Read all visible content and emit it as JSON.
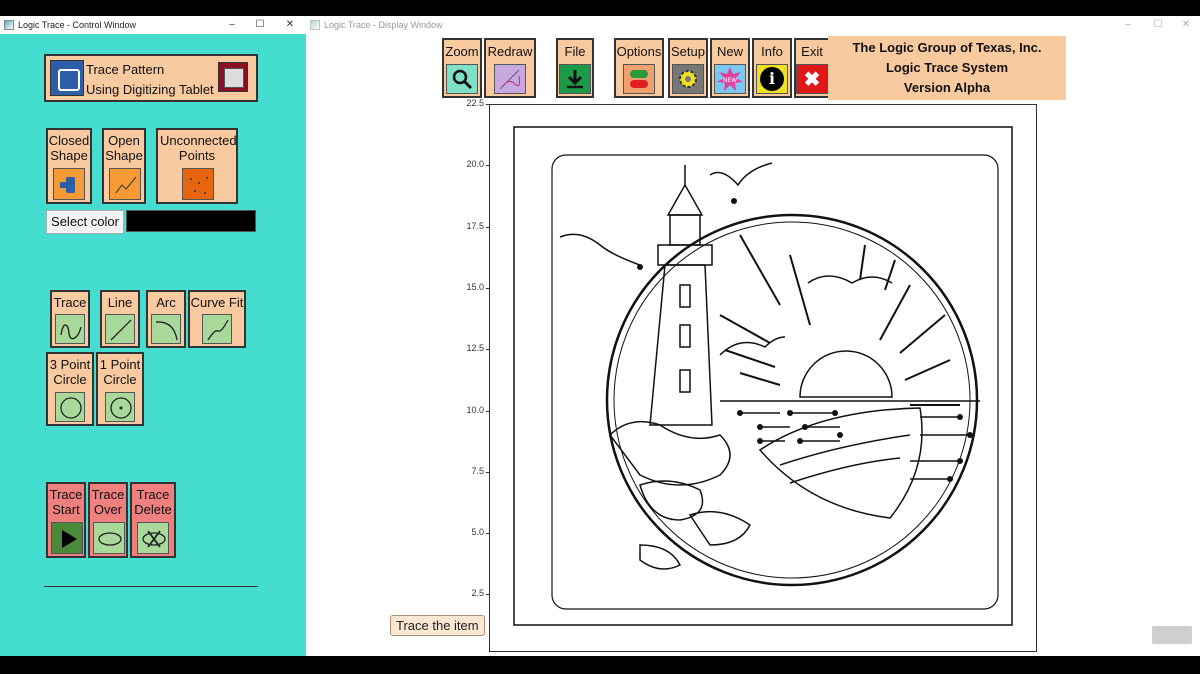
{
  "control_window": {
    "title": "Logic Trace - Control Window",
    "controls": {
      "minimize": "–",
      "maximize": "☐",
      "close": "✕"
    },
    "tablet": {
      "line1": "Trace Pattern",
      "line2": "Using Digitizing Tablet"
    },
    "shape_buttons": [
      {
        "label": "Closed Shape"
      },
      {
        "label": "Open Shape"
      },
      {
        "label": "Unconnected Points"
      }
    ],
    "select_color": {
      "label": "Select color",
      "value": "#000000"
    },
    "draw_buttons": [
      {
        "label": "Trace"
      },
      {
        "label": "Line"
      },
      {
        "label": "Arc"
      },
      {
        "label": "Curve Fit"
      },
      {
        "label": "3 Point Circle"
      },
      {
        "label": "1 Point Circle"
      }
    ],
    "trace_buttons": [
      {
        "label": "Trace Start"
      },
      {
        "label": "Trace Over"
      },
      {
        "label": "Trace Delete"
      }
    ],
    "colors": {
      "background": "#45ddd0",
      "button": "#f9c9a0",
      "icon_green": "#a8d89a",
      "icon_orange": "#f59a35",
      "trace_red": "#f08080"
    }
  },
  "display_window": {
    "title": "Logic Trace - Display Window",
    "controls": {
      "minimize": "–",
      "maximize": "☐",
      "close": "✕"
    },
    "toolbar": [
      {
        "label": "Zoom",
        "icon": "magnifier-icon"
      },
      {
        "label": "Redraw",
        "icon": "redraw-icon"
      },
      {
        "label": "File",
        "icon": "download-icon"
      },
      {
        "label": "Options",
        "icon": "toggle-icon"
      },
      {
        "label": "Setup",
        "icon": "gear-icon"
      },
      {
        "label": "New",
        "icon": "new-badge-icon",
        "badge": "NEW"
      },
      {
        "label": "Info",
        "icon": "info-icon",
        "glyph": "i"
      },
      {
        "label": "Exit",
        "icon": "close-icon",
        "glyph": "✖"
      }
    ],
    "company": {
      "line1": "The Logic Group of Texas, Inc.",
      "line2": "Logic Trace System",
      "line3": "Version Alpha"
    },
    "y_ticks": [
      "22.5",
      "20.0",
      "17.5",
      "15.0",
      "12.5",
      "10.0",
      "7.5",
      "5.0",
      "2.5"
    ],
    "tooltip": "Trace the item"
  }
}
